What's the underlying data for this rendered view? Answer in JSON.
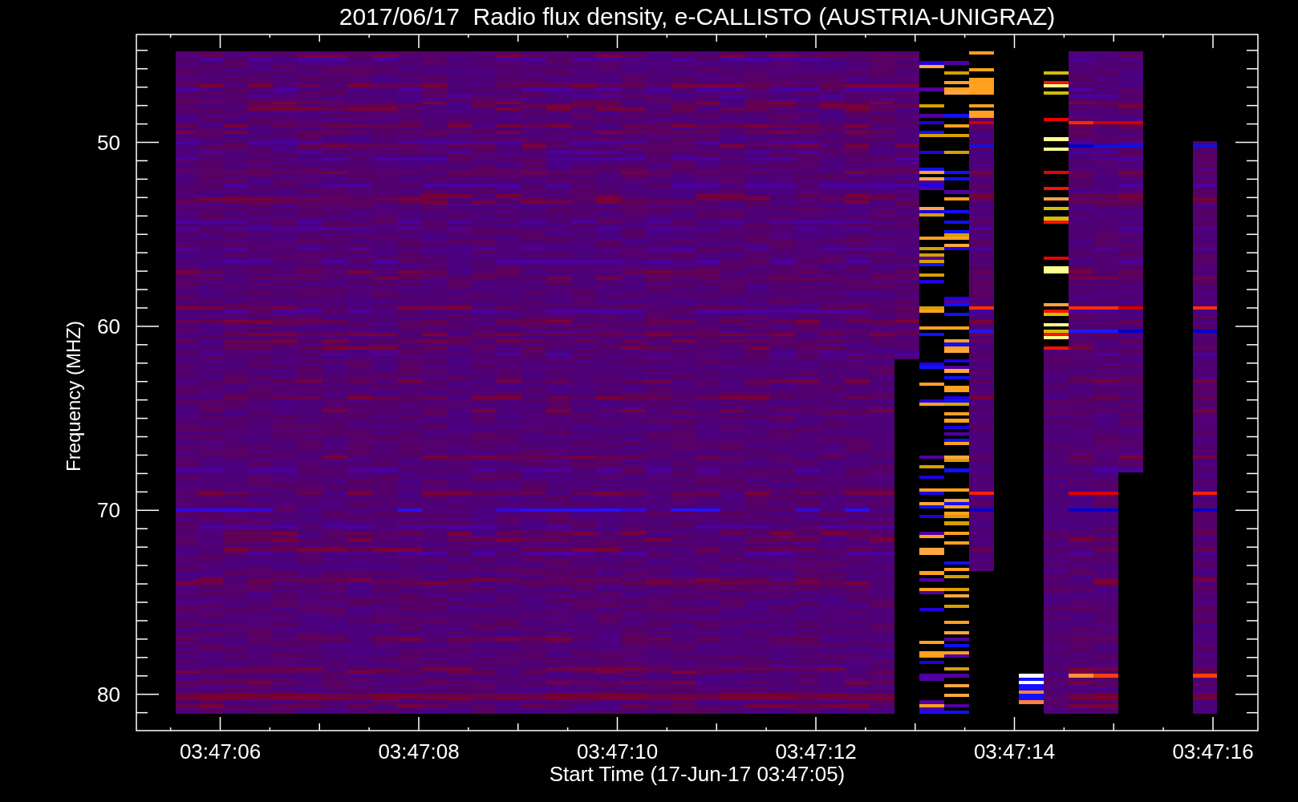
{
  "title": "2017/06/17  Radio flux density, e-CALLISTO (AUSTRIA-UNIGRAZ)",
  "y_axis": {
    "label": "Frequency (MHZ)",
    "tick_labels": [
      "50",
      "60",
      "70",
      "80"
    ]
  },
  "x_axis": {
    "label": "Start Time (17-Jun-17 03:47:05)",
    "tick_labels": [
      "03:47:06",
      "03:47:08",
      "03:47:10",
      "03:47:12",
      "03:47:14",
      "03:47:16"
    ]
  }
}
